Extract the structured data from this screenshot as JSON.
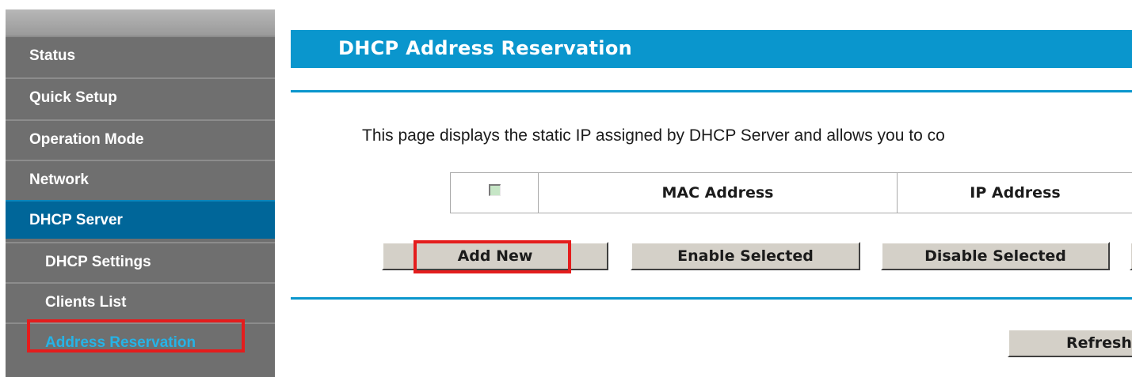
{
  "sidebar": {
    "items": [
      {
        "label": "Status"
      },
      {
        "label": "Quick Setup"
      },
      {
        "label": "Operation Mode"
      },
      {
        "label": "Network"
      },
      {
        "label": "DHCP Server"
      },
      {
        "label": "DHCP Settings"
      },
      {
        "label": "Clients List"
      },
      {
        "label": "Address Reservation"
      }
    ]
  },
  "header": {
    "title": "DHCP Address Reservation"
  },
  "main": {
    "description": "This page displays the static IP assigned by DHCP Server and allows you to co",
    "table": {
      "columns": [
        "MAC Address",
        "IP Address"
      ]
    },
    "buttons": {
      "add_new": "Add New",
      "enable_selected": "Enable Selected",
      "disable_selected": "Disable Selected",
      "refresh": "Refresh"
    }
  },
  "colors": {
    "sidebar_bg": "#6f6f6f",
    "active_item_bg": "#006699",
    "current_item_text": "#26b3e6",
    "header_bg": "#0a96cd",
    "highlight": "#e41d1d"
  }
}
